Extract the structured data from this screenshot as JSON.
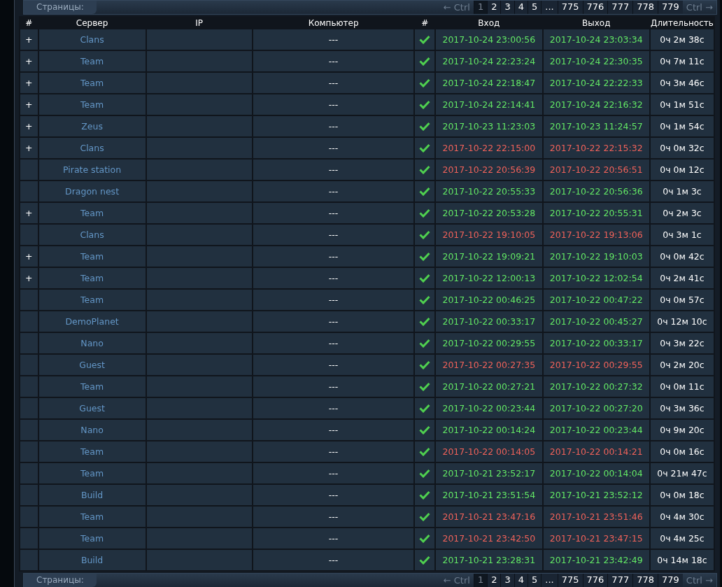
{
  "pager_top": {
    "label": "Страницы:",
    "prev": "← Ctrl",
    "next": "Ctrl →",
    "pages": [
      {
        "label": "1",
        "selected": true
      },
      {
        "label": "2",
        "selected": false
      },
      {
        "label": "3",
        "selected": false
      },
      {
        "label": "4",
        "selected": false
      },
      {
        "label": "5",
        "selected": false
      },
      {
        "label": "...",
        "selected": false
      },
      {
        "label": "775",
        "selected": false
      },
      {
        "label": "776",
        "selected": false
      },
      {
        "label": "777",
        "selected": false
      },
      {
        "label": "778",
        "selected": false
      },
      {
        "label": "779",
        "selected": false
      }
    ]
  },
  "table": {
    "columns": [
      "#",
      "Сервер",
      "IP",
      "Компьютер",
      "#",
      "Вход",
      "Выход",
      "Длительность"
    ],
    "rows": [
      {
        "expand": "+",
        "server": "Clans",
        "computer": "---",
        "checked": true,
        "flagged": false,
        "login": "2017-10-24 23:00:56",
        "logout": "2017-10-24 23:03:34",
        "duration": "0ч 2м 38с"
      },
      {
        "expand": "+",
        "server": "Team",
        "computer": "---",
        "checked": true,
        "flagged": false,
        "login": "2017-10-24 22:23:24",
        "logout": "2017-10-24 22:30:35",
        "duration": "0ч 7м 11с"
      },
      {
        "expand": "+",
        "server": "Team",
        "computer": "---",
        "checked": true,
        "flagged": false,
        "login": "2017-10-24 22:18:47",
        "logout": "2017-10-24 22:22:33",
        "duration": "0ч 3м 46с"
      },
      {
        "expand": "+",
        "server": "Team",
        "computer": "---",
        "checked": true,
        "flagged": false,
        "login": "2017-10-24 22:14:41",
        "logout": "2017-10-24 22:16:32",
        "duration": "0ч 1м 51с"
      },
      {
        "expand": "+",
        "server": "Zeus",
        "computer": "---",
        "checked": true,
        "flagged": false,
        "login": "2017-10-23 11:23:03",
        "logout": "2017-10-23 11:24:57",
        "duration": "0ч 1м 54с"
      },
      {
        "expand": "+",
        "server": "Clans",
        "computer": "---",
        "checked": true,
        "flagged": true,
        "login": "2017-10-22 22:15:00",
        "logout": "2017-10-22 22:15:32",
        "duration": "0ч 0м 32с"
      },
      {
        "server": "Pirate station",
        "computer": "---",
        "checked": true,
        "flagged": true,
        "login": "2017-10-22 20:56:39",
        "logout": "2017-10-22 20:56:51",
        "duration": "0ч 0м 12с"
      },
      {
        "server": "Dragon nest",
        "computer": "---",
        "checked": true,
        "flagged": false,
        "login": "2017-10-22 20:55:33",
        "logout": "2017-10-22 20:56:36",
        "duration": "0ч 1м 3с"
      },
      {
        "expand": "+",
        "server": "Team",
        "computer": "---",
        "checked": true,
        "flagged": false,
        "login": "2017-10-22 20:53:28",
        "logout": "2017-10-22 20:55:31",
        "duration": "0ч 2м 3с"
      },
      {
        "server": "Clans",
        "computer": "---",
        "checked": true,
        "flagged": true,
        "login": "2017-10-22 19:10:05",
        "logout": "2017-10-22 19:13:06",
        "duration": "0ч 3м 1с"
      },
      {
        "expand": "+",
        "server": "Team",
        "computer": "---",
        "checked": true,
        "flagged": false,
        "login": "2017-10-22 19:09:21",
        "logout": "2017-10-22 19:10:03",
        "duration": "0ч 0м 42с"
      },
      {
        "expand": "+",
        "server": "Team",
        "computer": "---",
        "checked": true,
        "flagged": false,
        "login": "2017-10-22 12:00:13",
        "logout": "2017-10-22 12:02:54",
        "duration": "0ч 2м 41с"
      },
      {
        "server": "Team",
        "computer": "---",
        "checked": true,
        "flagged": false,
        "login": "2017-10-22 00:46:25",
        "logout": "2017-10-22 00:47:22",
        "duration": "0ч 0м 57с"
      },
      {
        "server": "DemoPlanet",
        "computer": "---",
        "checked": true,
        "flagged": false,
        "login": "2017-10-22 00:33:17",
        "logout": "2017-10-22 00:45:27",
        "duration": "0ч 12м 10с"
      },
      {
        "server": "Nano",
        "computer": "---",
        "checked": true,
        "flagged": false,
        "login": "2017-10-22 00:29:55",
        "logout": "2017-10-22 00:33:17",
        "duration": "0ч 3м 22с"
      },
      {
        "server": "Guest",
        "computer": "---",
        "checked": true,
        "flagged": true,
        "login": "2017-10-22 00:27:35",
        "logout": "2017-10-22 00:29:55",
        "duration": "0ч 2м 20с"
      },
      {
        "server": "Team",
        "computer": "---",
        "checked": true,
        "flagged": false,
        "login": "2017-10-22 00:27:21",
        "logout": "2017-10-22 00:27:32",
        "duration": "0ч 0м 11с"
      },
      {
        "server": "Guest",
        "computer": "---",
        "checked": true,
        "flagged": false,
        "login": "2017-10-22 00:23:44",
        "logout": "2017-10-22 00:27:20",
        "duration": "0ч 3м 36с"
      },
      {
        "server": "Nano",
        "computer": "---",
        "checked": true,
        "flagged": false,
        "login": "2017-10-22 00:14:24",
        "logout": "2017-10-22 00:23:44",
        "duration": "0ч 9м 20с"
      },
      {
        "server": "Team",
        "computer": "---",
        "checked": true,
        "flagged": true,
        "login": "2017-10-22 00:14:05",
        "logout": "2017-10-22 00:14:21",
        "duration": "0ч 0м 16с"
      },
      {
        "server": "Team",
        "computer": "---",
        "checked": true,
        "flagged": false,
        "login": "2017-10-21 23:52:17",
        "logout": "2017-10-22 00:14:04",
        "duration": "0ч 21м 47с"
      },
      {
        "server": "Build",
        "computer": "---",
        "checked": true,
        "flagged": false,
        "login": "2017-10-21 23:51:54",
        "logout": "2017-10-21 23:52:12",
        "duration": "0ч 0м 18с"
      },
      {
        "server": "Team",
        "computer": "---",
        "checked": true,
        "flagged": true,
        "login": "2017-10-21 23:47:16",
        "logout": "2017-10-21 23:51:46",
        "duration": "0ч 4м 30с"
      },
      {
        "server": "Team",
        "computer": "---",
        "checked": true,
        "flagged": true,
        "login": "2017-10-21 23:42:50",
        "logout": "2017-10-21 23:47:15",
        "duration": "0ч 4м 25с"
      },
      {
        "server": "Build",
        "computer": "---",
        "checked": true,
        "flagged": false,
        "login": "2017-10-21 23:28:31",
        "logout": "2017-10-21 23:42:49",
        "duration": "0ч 14м 18с"
      }
    ]
  },
  "pager_bottom": {
    "label": "Страницы:",
    "prev": "← Ctrl",
    "next": "Ctrl →",
    "pages": [
      {
        "label": "1",
        "selected": true
      },
      {
        "label": "2",
        "selected": false
      },
      {
        "label": "3",
        "selected": false
      },
      {
        "label": "4",
        "selected": false
      },
      {
        "label": "5",
        "selected": false
      },
      {
        "label": "...",
        "selected": false
      },
      {
        "label": "775",
        "selected": false
      },
      {
        "label": "776",
        "selected": false
      },
      {
        "label": "777",
        "selected": false
      },
      {
        "label": "778",
        "selected": false
      },
      {
        "label": "779",
        "selected": false
      }
    ]
  }
}
